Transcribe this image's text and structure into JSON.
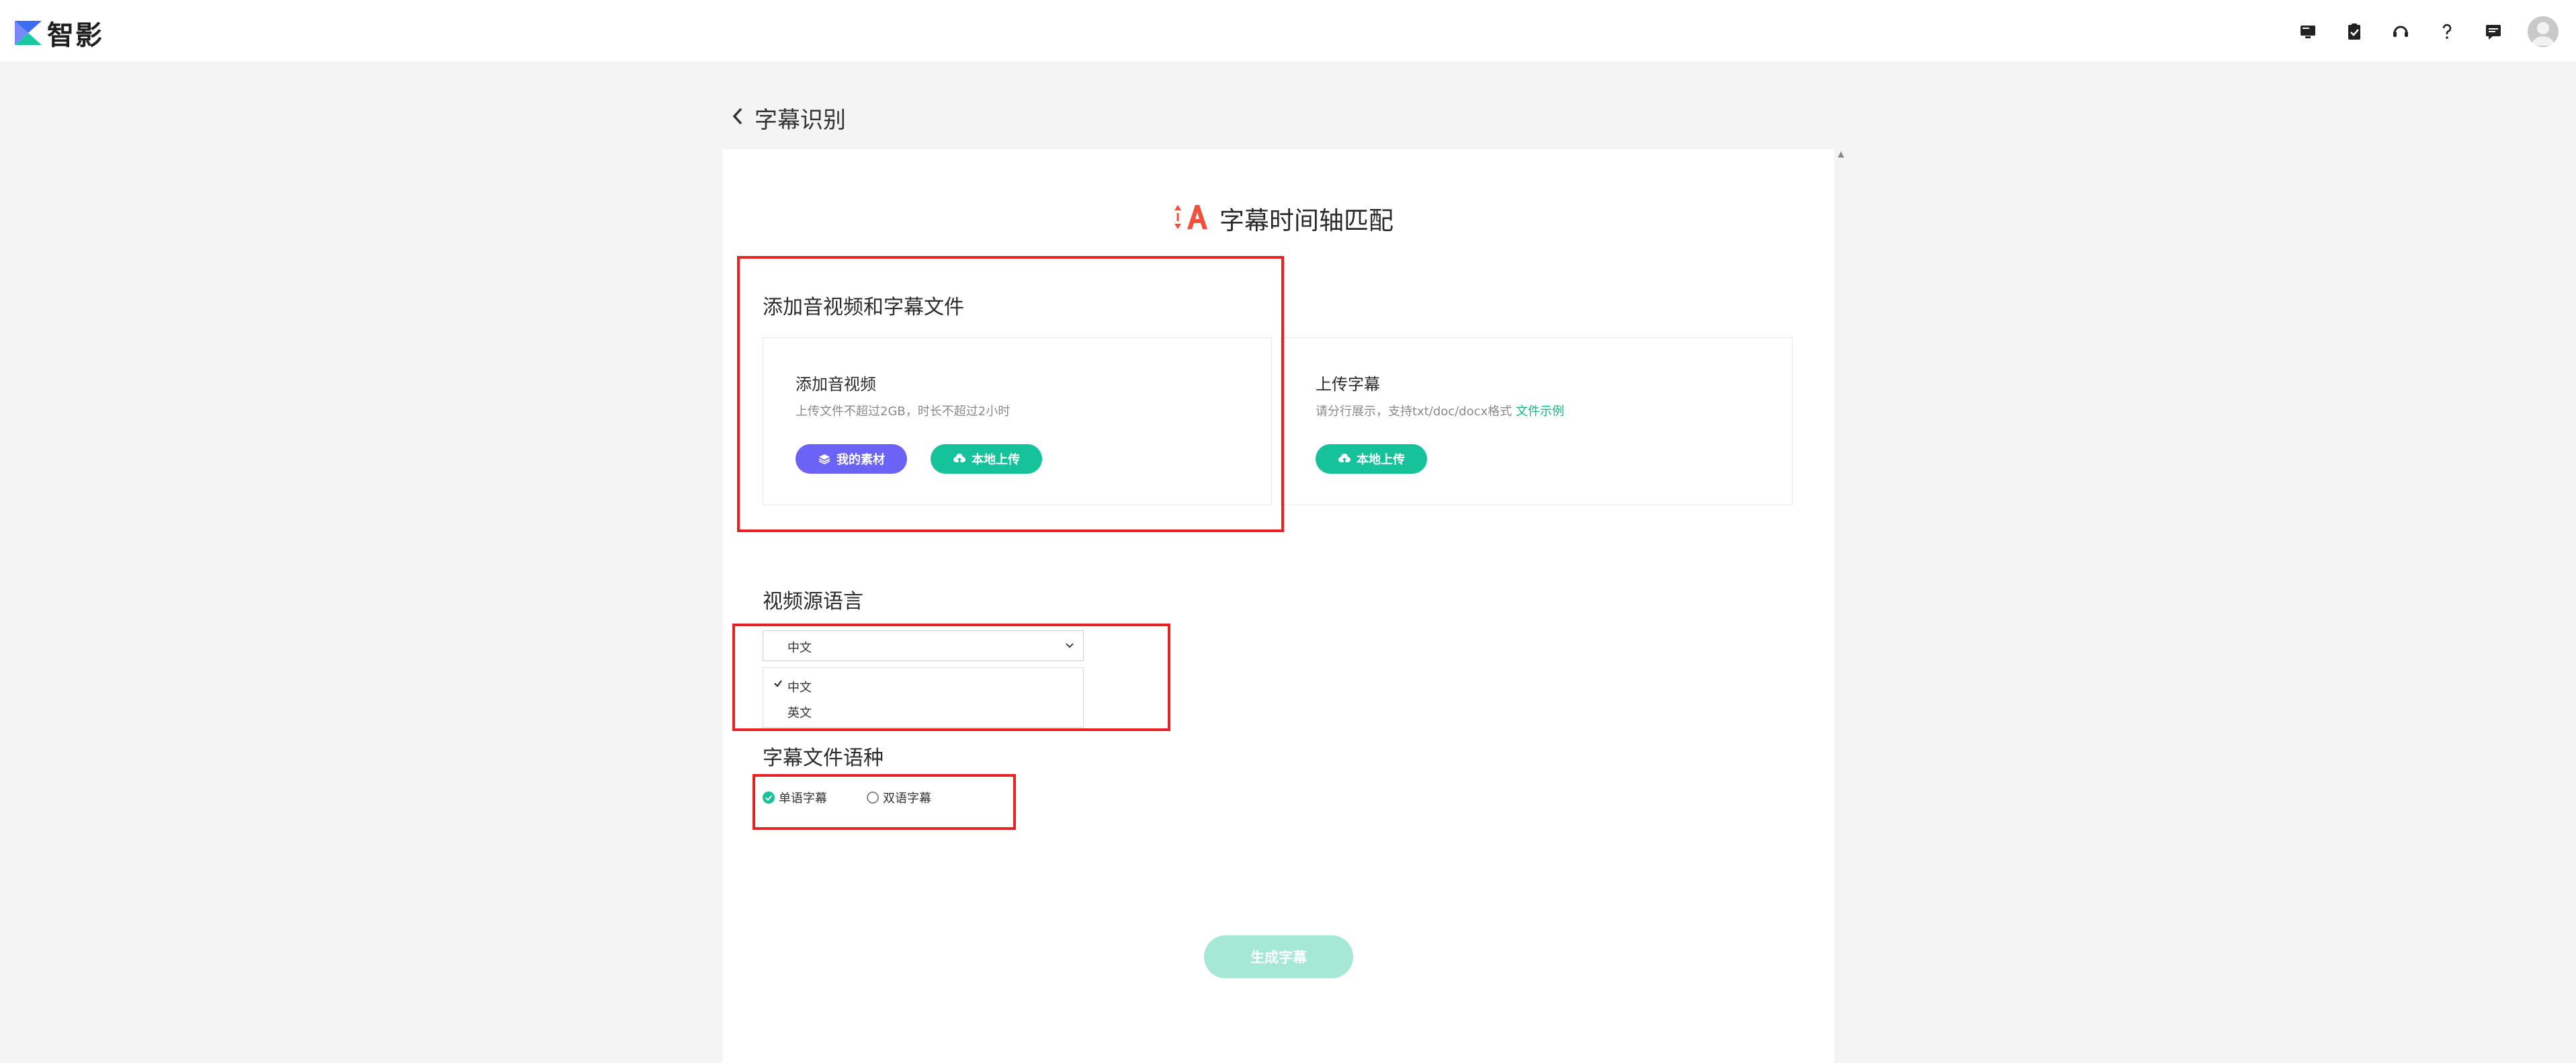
{
  "app": {
    "name": "智影",
    "brand_colors": {
      "blue": "#3d6cf5",
      "green": "#19c8a0",
      "accent_red": "#f0503c"
    }
  },
  "topbar": {
    "icons": [
      "monitor-icon",
      "clipboard-check-icon",
      "headset-icon",
      "help-icon",
      "message-icon",
      "avatar"
    ]
  },
  "page": {
    "title": "字幕识别"
  },
  "feature": {
    "title": "字幕时间轴匹配"
  },
  "add_files": {
    "label": "添加音视频和字幕文件",
    "media": {
      "title": "添加音视频",
      "desc": "上传文件不超过2GB，时长不超过2小时",
      "my_assets_label": "我的素材",
      "local_upload_label": "本地上传"
    },
    "subtitle": {
      "title": "上传字幕",
      "desc": "请分行展示，支持txt/doc/docx格式",
      "example_link": "文件示例",
      "local_upload_label": "本地上传"
    }
  },
  "source_language": {
    "label": "视频源语言",
    "selected": "中文",
    "options": [
      {
        "label": "中文",
        "checked": true
      },
      {
        "label": "英文",
        "checked": false
      }
    ]
  },
  "subtitle_lang_type": {
    "label": "字幕文件语种",
    "options": [
      {
        "label": "单语字幕",
        "checked": true
      },
      {
        "label": "双语字幕",
        "checked": false
      }
    ]
  },
  "generate": {
    "label": "生成字幕",
    "enabled": false
  },
  "annotation_color": "#e82222"
}
